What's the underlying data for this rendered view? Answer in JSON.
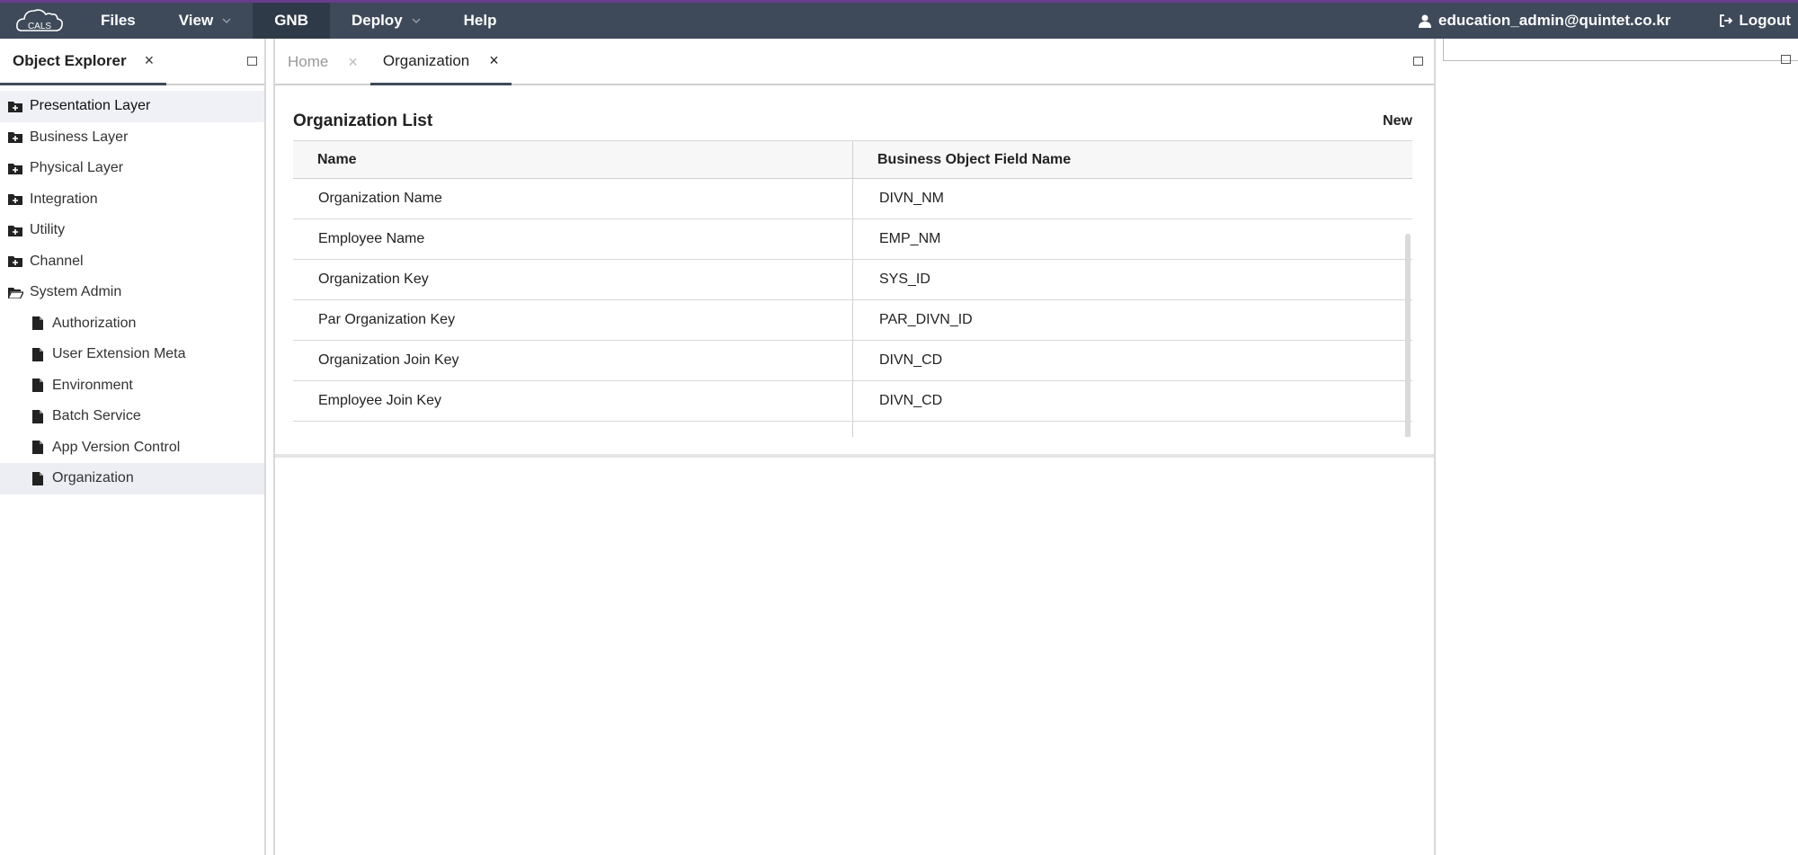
{
  "topbar": {
    "logo_text": "CALS",
    "menu": [
      {
        "label": "Files",
        "dropdown": false
      },
      {
        "label": "View",
        "dropdown": true
      },
      {
        "label": "GNB",
        "dropdown": false
      },
      {
        "label": "Deploy",
        "dropdown": true
      },
      {
        "label": "Help",
        "dropdown": false
      }
    ],
    "user_email": "education_admin@quintet.co.kr",
    "logout_label": "Logout",
    "colors": {
      "bar": "#3e4a5a",
      "accent": "#6a3c8c",
      "active": "#2f3a48"
    }
  },
  "explorer": {
    "tab_label": "Object Explorer",
    "close_glyph": "×",
    "items": [
      {
        "label": "Presentation Layer",
        "icon": "folder-plus-icon"
      },
      {
        "label": "Business Layer",
        "icon": "folder-plus-icon"
      },
      {
        "label": "Physical Layer",
        "icon": "folder-plus-icon"
      },
      {
        "label": "Integration",
        "icon": "folder-plus-icon"
      },
      {
        "label": "Utility",
        "icon": "folder-plus-icon"
      },
      {
        "label": "Channel",
        "icon": "folder-plus-icon"
      },
      {
        "label": "System Admin",
        "icon": "folder-open-icon"
      }
    ],
    "children": [
      {
        "label": "Authorization",
        "icon": "file-icon"
      },
      {
        "label": "User Extension Meta",
        "icon": "file-icon"
      },
      {
        "label": "Environment",
        "icon": "file-icon"
      },
      {
        "label": "Batch Service",
        "icon": "file-icon"
      },
      {
        "label": "App Version Control",
        "icon": "file-icon"
      },
      {
        "label": "Organization",
        "icon": "file-icon"
      }
    ]
  },
  "center": {
    "tabs": [
      {
        "label": "Home",
        "close": "×"
      },
      {
        "label": "Organization",
        "close": "×"
      }
    ],
    "list": {
      "title": "Organization List",
      "new_label": "New",
      "columns": [
        "Name",
        "Business Object Field Name"
      ],
      "rows": [
        [
          "Organization Name",
          "DIVN_NM"
        ],
        [
          "Employee Name",
          "EMP_NM"
        ],
        [
          "Organization Key",
          "SYS_ID"
        ],
        [
          "Par Organization Key",
          "PAR_DIVN_ID"
        ],
        [
          "Organization Join Key",
          "DIVN_CD"
        ],
        [
          "Employee Join Key",
          "DIVN_CD"
        ]
      ]
    }
  }
}
